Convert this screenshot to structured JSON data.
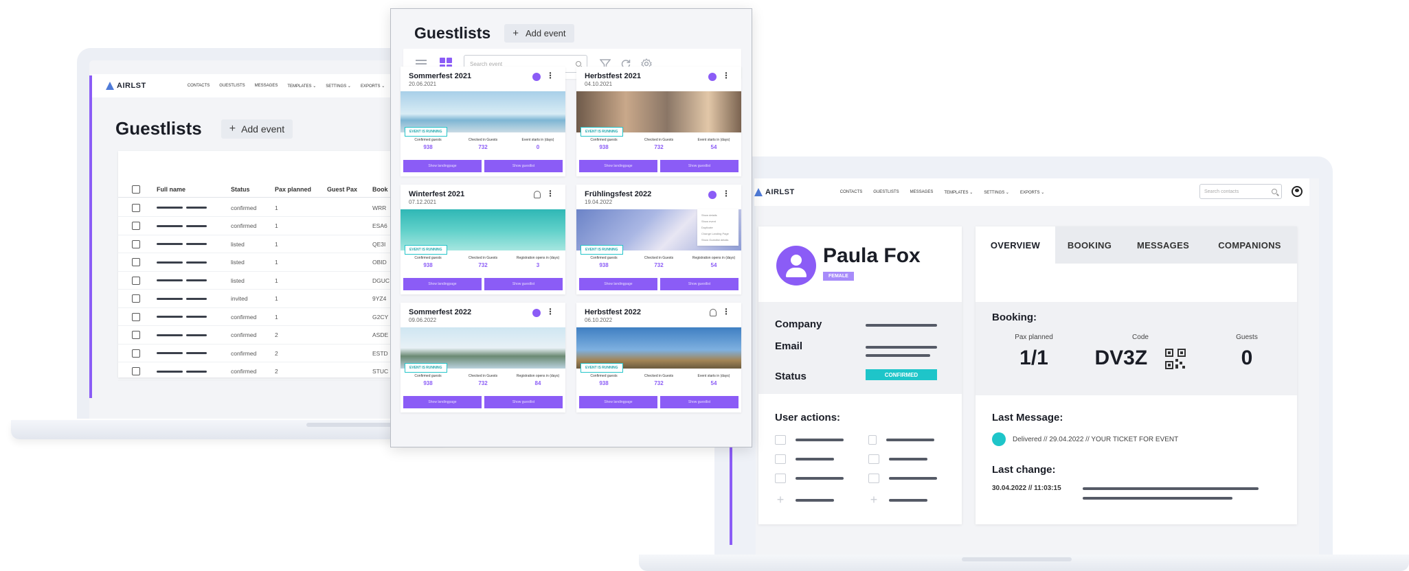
{
  "left_app": {
    "logo": "AIRLST",
    "nav": [
      "CONTACTS",
      "GUESTLISTS",
      "MESSAGES",
      "TEMPLATES ⌄",
      "SETTINGS ⌄",
      "EXPORTS ⌄"
    ],
    "title": "Guestlists",
    "add_event": "Add event",
    "table": {
      "headers": [
        "Full name",
        "Status",
        "Pax planned",
        "Guest Pax",
        "Book"
      ],
      "rows": [
        {
          "status": "confirmed",
          "pax": "1",
          "book": "WRR"
        },
        {
          "status": "confirmed",
          "pax": "1",
          "book": "ESA6"
        },
        {
          "status": "listed",
          "pax": "1",
          "book": "QE3I"
        },
        {
          "status": "listed",
          "pax": "1",
          "book": "OBID"
        },
        {
          "status": "listed",
          "pax": "1",
          "book": "DGUC"
        },
        {
          "status": "invited",
          "pax": "1",
          "book": "9YZ4"
        },
        {
          "status": "confirmed",
          "pax": "1",
          "book": "G2CY"
        },
        {
          "status": "confirmed",
          "pax": "2",
          "book": "ASDE"
        },
        {
          "status": "confirmed",
          "pax": "2",
          "book": "ESTD"
        },
        {
          "status": "confirmed",
          "pax": "2",
          "book": "STUC"
        }
      ]
    }
  },
  "center": {
    "title": "Guestlists",
    "add_event": "Add event",
    "search_placeholder": "Search event",
    "stat_labels": [
      "Confirmed guests",
      "Checked in Guests",
      "Event starts in (days)"
    ],
    "button_labels": [
      "Show landingpage",
      "Show guestlist"
    ],
    "tag": "EVENT IS RUNNING",
    "events": [
      {
        "title": "Sommerfest 2021",
        "date": "20.06.2021",
        "stats": [
          "938",
          "732",
          "0"
        ],
        "stat_labels": [
          "Confirmed guests",
          "Checked in Guests",
          "Event starts in (days)"
        ]
      },
      {
        "title": "Herbstfest 2021",
        "date": "04.10.2021",
        "stats": [
          "938",
          "732",
          "54"
        ],
        "stat_labels": [
          "Confirmed guests",
          "Checked in Guests",
          "Event starts in (days)"
        ]
      },
      {
        "title": "Winterfest 2021",
        "date": "07.12.2021",
        "stats": [
          "938",
          "732",
          "3"
        ],
        "stat_labels": [
          "Confirmed guests",
          "Checked in Guests",
          "Registration opens in (days)"
        ]
      },
      {
        "title": "Frühlingsfest 2022",
        "date": "19.04.2022",
        "stats": [
          "938",
          "732",
          "54"
        ],
        "stat_labels": [
          "Confirmed guests",
          "Checked in Guests",
          "Registration opens in (days)"
        ]
      },
      {
        "title": "Sommerfest 2022",
        "date": "09.06.2022",
        "stats": [
          "938",
          "732",
          "84"
        ],
        "stat_labels": [
          "Confirmed guests",
          "Checked in Guests",
          "Registration opens in (days)"
        ]
      },
      {
        "title": "Herbstfest 2022",
        "date": "06.10.2022",
        "stats": [
          "938",
          "732",
          "54"
        ],
        "stat_labels": [
          "Confirmed guests",
          "Checked in Guests",
          "Event starts in (days)"
        ]
      }
    ],
    "context_menu": [
      "Show details",
      "Show event",
      "Duplicate",
      "Change Landing Page",
      "Show Guestlist details"
    ]
  },
  "right_app": {
    "logo": "AIRLST",
    "nav": [
      "CONTACTS",
      "GUESTLISTS",
      "MESSAGES",
      "TEMPLATES ⌄",
      "SETTINGS ⌄",
      "EXPORTS ⌄"
    ],
    "search_placeholder": "Search contacts",
    "profile": {
      "name": "Paula Fox",
      "gender": "FEMALE",
      "company_label": "Company",
      "email_label": "Email",
      "status_label": "Status",
      "status_value": "CONFIRMED",
      "user_actions": "User actions:"
    },
    "tabs": [
      "OVERVIEW",
      "BOOKING",
      "MESSAGES",
      "COMPANIONS"
    ],
    "booking": {
      "title": "Booking:",
      "pax_label": "Pax planned",
      "pax_value": "1/1",
      "code_label": "Code",
      "code_value": "DV3Z",
      "guests_label": "Guests",
      "guests_value": "0"
    },
    "last_message": {
      "title": "Last Message:",
      "text": "Delivered  //  29.04.2022  //  YOUR TICKET FOR EVENT"
    },
    "last_change": {
      "title": "Last change:",
      "text": "30.04.2022  //  11:03:15"
    }
  },
  "colors": {
    "accent": "#8b5cf6",
    "teal": "#1ec5c9"
  }
}
